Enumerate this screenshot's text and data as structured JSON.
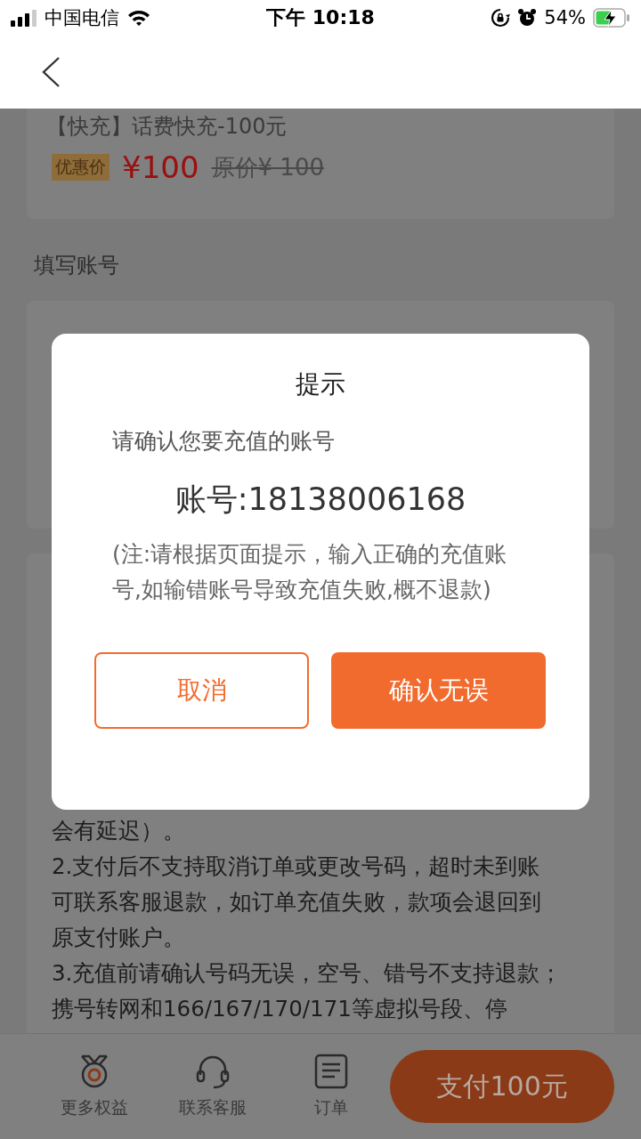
{
  "status_bar": {
    "carrier": "中国电信",
    "time": "下午 10:18",
    "battery": "54%"
  },
  "product": {
    "title": "【快充】话费快充-100元",
    "tag": "优惠价",
    "price": "¥100",
    "original_price": "原价¥ 100"
  },
  "account_section": {
    "label": "填写账号"
  },
  "notes": [
    "会有延迟）。",
    "2.支付后不支持取消订单或更改号码，超时未到账可联系客服退款，如订单充值失败，款项会退回到原支付账户。",
    "3.充值前请确认号码无误，空号、错号不支持退款；携号转网和166/167/170/171等虚拟号段、停"
  ],
  "footer": {
    "items": [
      {
        "kind": "medal",
        "label": "更多权益"
      },
      {
        "kind": "headset",
        "label": "联系客服"
      },
      {
        "kind": "list",
        "label": "订单"
      }
    ],
    "pay_button": "支付100元"
  },
  "dialog": {
    "title": "提示",
    "message": "请确认您要充值的账号",
    "account": "账号:18138006168",
    "note": "(注:请根据页面提示，输入正确的充值账号,如输错账号导致充值失败,概不退款)",
    "buttons": [
      {
        "kind": "secondary",
        "label": "取消"
      },
      {
        "kind": "primary",
        "label": "确认无误"
      }
    ]
  }
}
